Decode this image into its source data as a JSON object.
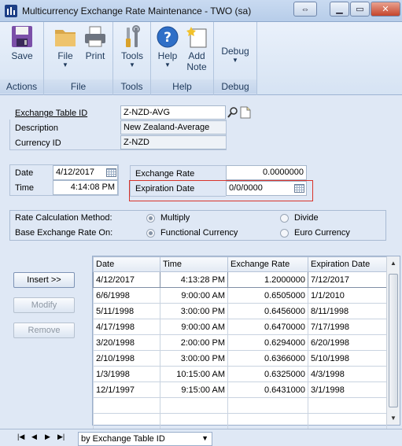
{
  "window": {
    "title": "Multicurrency Exchange Rate Maintenance  -  TWO (sa)"
  },
  "ribbon": {
    "groups": [
      {
        "label": "Actions",
        "buttons": [
          {
            "label": "Save",
            "icon": "floppy-disk-icon"
          }
        ]
      },
      {
        "label": "File",
        "buttons": [
          {
            "label": "File",
            "icon": "folder-icon"
          },
          {
            "label": "Print",
            "icon": "printer-icon"
          }
        ]
      },
      {
        "label": "Tools",
        "buttons": [
          {
            "label": "Tools",
            "icon": "tools-icon"
          }
        ]
      },
      {
        "label": "Help",
        "buttons": [
          {
            "label": "Help",
            "icon": "help-icon"
          },
          {
            "label": "Add",
            "label2": "Note",
            "icon": "note-icon"
          }
        ]
      },
      {
        "label": "Debug",
        "buttons": [
          {
            "label": "Debug",
            "icon": "debug-icon"
          }
        ]
      }
    ]
  },
  "header_fields": {
    "exchange_table_id_label": "Exchange Table ID",
    "exchange_table_id_value": "Z-NZD-AVG",
    "description_label": "Description",
    "description_value": "New Zealand-Average",
    "currency_id_label": "Currency ID",
    "currency_id_value": "Z-NZD"
  },
  "rate_fields": {
    "date_label": "Date",
    "date_value": "4/12/2017",
    "time_label": "Time",
    "time_value": "4:14:08 PM",
    "exchange_rate_label": "Exchange Rate",
    "exchange_rate_value": "0.0000000",
    "expiration_date_label": "Expiration Date",
    "expiration_date_value": "0/0/0000"
  },
  "options": {
    "rate_calc_label": "Rate Calculation Method:",
    "rate_calc_option1": "Multiply",
    "rate_calc_option2": "Divide",
    "base_rate_label": "Base Exchange Rate On:",
    "base_rate_option1": "Functional Currency",
    "base_rate_option2": "Euro Currency"
  },
  "buttons": {
    "insert": "Insert >>",
    "modify": "Modify",
    "remove": "Remove"
  },
  "grid": {
    "columns": [
      "Date",
      "Time",
      "Exchange Rate",
      "Expiration Date"
    ],
    "rows": [
      [
        "4/12/2017",
        "4:13:28 PM",
        "1.2000000",
        "7/12/2017"
      ],
      [
        "6/6/1998",
        "9:00:00 AM",
        "0.6505000",
        "1/1/2010"
      ],
      [
        "5/11/1998",
        "3:00:00 PM",
        "0.6456000",
        "8/11/1998"
      ],
      [
        "4/17/1998",
        "9:00:00 AM",
        "0.6470000",
        "7/17/1998"
      ],
      [
        "3/20/1998",
        "2:00:00 PM",
        "0.6294000",
        "6/20/1998"
      ],
      [
        "2/10/1998",
        "3:00:00 PM",
        "0.6366000",
        "5/10/1998"
      ],
      [
        "1/3/1998",
        "10:15:00 AM",
        "0.6325000",
        "4/3/1998"
      ],
      [
        "12/1/1997",
        "9:15:00 AM",
        "0.6431000",
        "3/1/1998"
      ],
      [
        "",
        "",
        "",
        ""
      ],
      [
        "",
        "",
        "",
        ""
      ]
    ]
  },
  "footer": {
    "sort_by": "by Exchange Table ID"
  },
  "colors": {
    "window_bg": "#dfe8f5",
    "highlight_border": "#d9342b",
    "ribbon_text": "#1e395b"
  }
}
